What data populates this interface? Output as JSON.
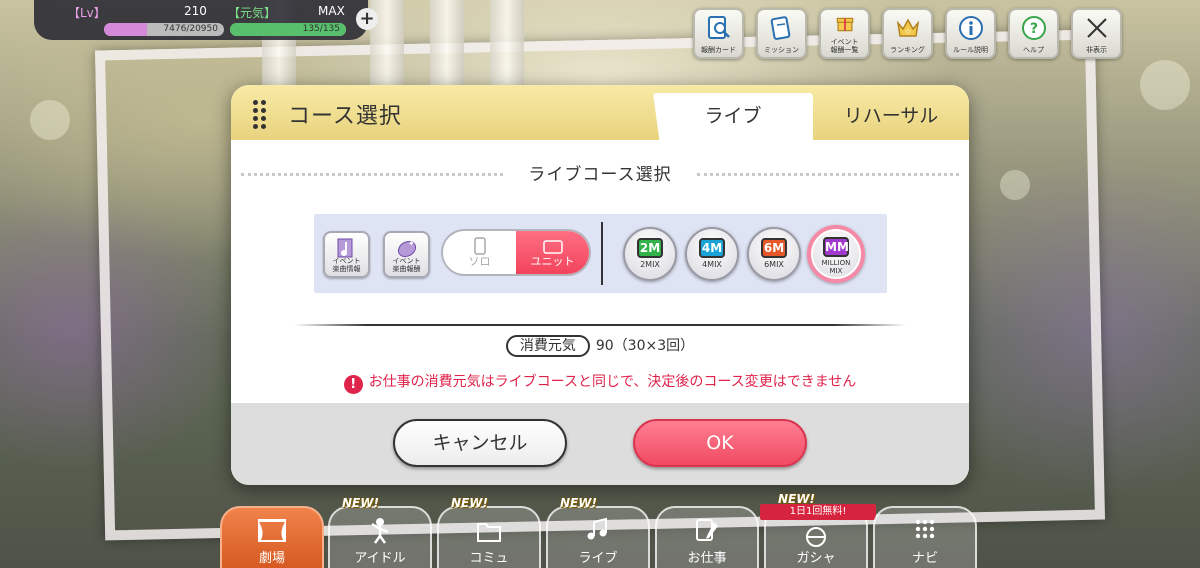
{
  "status": {
    "lv_label": "【Lv】",
    "lv_value": "210",
    "exp": "7476/20950",
    "exp_fill": 0.357,
    "genki_label": "【元気】",
    "genki_max": "MAX",
    "genki": "135/135",
    "genki_fill": 1.0
  },
  "top_menu": [
    {
      "label": "報酬カード",
      "icon": "card-search-icon"
    },
    {
      "label": "ミッション",
      "icon": "mission-card-icon"
    },
    {
      "label": "イベント\n報酬一覧",
      "icon": "gift-box-icon"
    },
    {
      "label": "ランキング",
      "icon": "star-crown-icon"
    },
    {
      "label": "ルール説明",
      "icon": "info-icon"
    },
    {
      "label": "ヘルプ",
      "icon": "help-icon"
    },
    {
      "label": "非表示",
      "icon": "close-icon"
    }
  ],
  "dialog": {
    "title": "コース選択",
    "tabs": [
      "ライブ",
      "リハーサル"
    ],
    "active_tab": "ライブ",
    "section_title": "ライブコース選択",
    "buttons": [
      {
        "label": "イベント\n楽曲情報",
        "icon": "music-note-icon"
      },
      {
        "label": "イベント\n楽曲報酬",
        "icon": "reward-icon"
      }
    ],
    "mode_toggle": {
      "solo": "ソロ",
      "unit": "ユニット",
      "selected": "ユニット"
    },
    "mixes": [
      {
        "badge": "2M",
        "label": "2MIX",
        "color": "#33b24a"
      },
      {
        "badge": "4M",
        "label": "4MIX",
        "color": "#1aa3d6"
      },
      {
        "badge": "6M",
        "label": "6MIX",
        "color": "#e6582a"
      },
      {
        "badge": "MM",
        "label": "MILLION\nMIX",
        "color": "#a23ad0",
        "selected": true
      }
    ],
    "cost_label": "消費元気",
    "cost_value": "90（30×3回）",
    "warning": "お仕事の消費元気はライブコースと同じで、決定後のコース変更はできません",
    "warning_icon": "!",
    "cancel": "キャンセル",
    "ok": "OK"
  },
  "nav": {
    "new_tag": "NEW!",
    "free_tag": "1日1回無料!",
    "items": [
      {
        "label": "劇場",
        "new": false,
        "active": true
      },
      {
        "label": "アイドル",
        "new": true
      },
      {
        "label": "コミュ",
        "new": true
      },
      {
        "label": "ライブ",
        "new": true
      },
      {
        "label": "お仕事",
        "new": false
      },
      {
        "label": "ガシャ",
        "new": true,
        "free": true
      },
      {
        "label": "ナビ",
        "new": false
      }
    ]
  },
  "colors": {
    "accent_pink": "#f04a62",
    "header_gold": "#e8d37e",
    "nav_active": "#d65a21",
    "warning_red": "#e0234a"
  }
}
